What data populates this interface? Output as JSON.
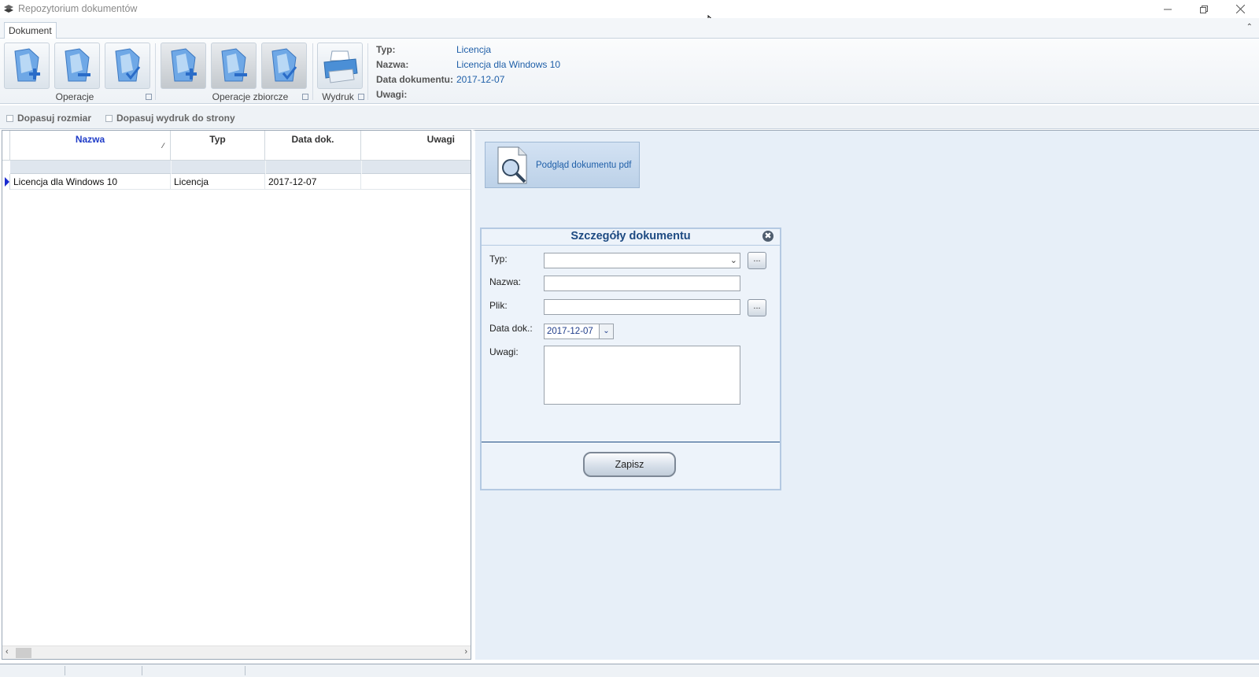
{
  "window": {
    "title": "Repozytorium dokumentów",
    "controls": [
      "minimize",
      "restore",
      "close"
    ]
  },
  "ribbon": {
    "tabs": [
      {
        "label": "Dokument",
        "active": true
      }
    ],
    "groups": [
      {
        "label": "Operacje",
        "buttons": [
          "add-document-icon",
          "remove-document-icon",
          "check-document-icon"
        ]
      },
      {
        "label": "Operacje zbiorcze",
        "buttons": [
          "bulk-add-icon",
          "bulk-remove-icon",
          "bulk-check-icon"
        ]
      },
      {
        "label": "Wydruk",
        "buttons": [
          "printer-icon"
        ]
      }
    ],
    "info": {
      "typ_label": "Typ:",
      "typ_value": "Licencja",
      "nazwa_label": "Nazwa:",
      "nazwa_value": "Licencja dla Windows 10",
      "data_label": "Data dokumentu:",
      "data_value": "2017-12-07",
      "uwagi_label": "Uwagi:",
      "uwagi_value": ""
    }
  },
  "options": {
    "fit_size": {
      "label": "Dopasuj rozmiar",
      "checked": false
    },
    "fit_print": {
      "label": "Dopasuj wydruk do strony",
      "checked": false
    }
  },
  "grid": {
    "columns": [
      "Nazwa",
      "Typ",
      "Data dok.",
      "Uwagi"
    ],
    "rows": [
      {
        "nazwa": "Licencja dla Windows 10",
        "typ": "Licencja",
        "data": "2017-12-07",
        "uwagi": ""
      }
    ]
  },
  "preview": {
    "label": "Podgląd dokumentu pdf"
  },
  "details": {
    "title": "Szczegóły dokumentu",
    "typ_label": "Typ:",
    "typ_value": "",
    "nazwa_label": "Nazwa:",
    "nazwa_value": "",
    "plik_label": "Plik:",
    "plik_value": "",
    "data_label": "Data dok.:",
    "data_value": "2017-12-07",
    "uwagi_label": "Uwagi:",
    "uwagi_value": "",
    "browse_label": "...",
    "save_label": "Zapisz"
  },
  "colors": {
    "accent": "#1f5fa8",
    "panel_bg": "#e7eff8",
    "dialog_title": "#1d4a82",
    "header_active": "#1f3cc8"
  }
}
